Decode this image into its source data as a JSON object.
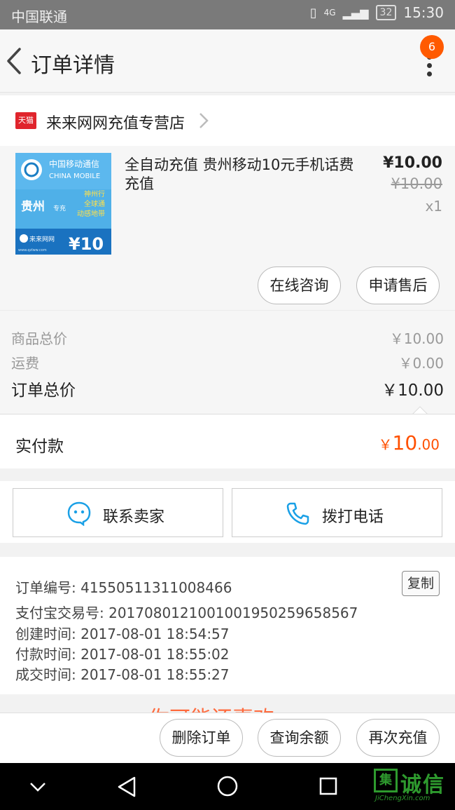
{
  "status_bar": {
    "carrier": "中国联通",
    "network": "4G",
    "battery": "32",
    "time": "15:30"
  },
  "nav": {
    "title": "订单详情",
    "badge_count": "6"
  },
  "shop": {
    "platform_badge": "天猫",
    "name": "来来网网充值专营店"
  },
  "item": {
    "thumbnail": {
      "brand_cn": "中国移动通信",
      "brand_en": "CHINA MOBILE",
      "region": "贵州",
      "region_suffix": "专充",
      "slogan_1": "神州行",
      "slogan_2": "全球通",
      "slogan_3": "动感地带",
      "logo_text": "来来网网",
      "logo_url_text": "www.qzlww.com",
      "amount": "¥10"
    },
    "title": "全自动充值 贵州移动10元手机话费充值",
    "price": "¥10.00",
    "original_price": "¥10.00",
    "quantity": "x1",
    "consult_label": "在线咨询",
    "aftersale_label": "申请售后"
  },
  "totals": {
    "goods_label": "商品总价",
    "goods_value": "￥10.00",
    "shipping_label": "运费",
    "shipping_value": "￥0.00",
    "order_total_label": "订单总价",
    "order_total_value": "￥10.00"
  },
  "paid": {
    "label": "实付款",
    "currency": "￥",
    "integer": "10",
    "decimal": ".00"
  },
  "contact": {
    "seller_label": "联系卖家",
    "phone_label": "拨打电话"
  },
  "order_info": {
    "order_no": "订单编号: 41550511311008466",
    "copy_label": "复制",
    "alipay_no": "支付宝交易号: 2017080121001001950259658567",
    "created": "创建时间: 2017-08-01 18:54:57",
    "paid_time": "付款时间: 2017-08-01 18:55:02",
    "closed": "成交时间: 2017-08-01 18:55:27"
  },
  "recommend": {
    "text": "你可能还喜欢"
  },
  "actions": {
    "delete_label": "删除订单",
    "balance_label": "查询余额",
    "recharge_label": "再次充值"
  },
  "watermark": {
    "box_char": "集",
    "text_cn": "诚信",
    "text_en": "JiChengXin.com"
  },
  "colors": {
    "accent": "#ff5000",
    "tmall_red": "#e0242c",
    "contact_blue": "#1aa0e6"
  }
}
